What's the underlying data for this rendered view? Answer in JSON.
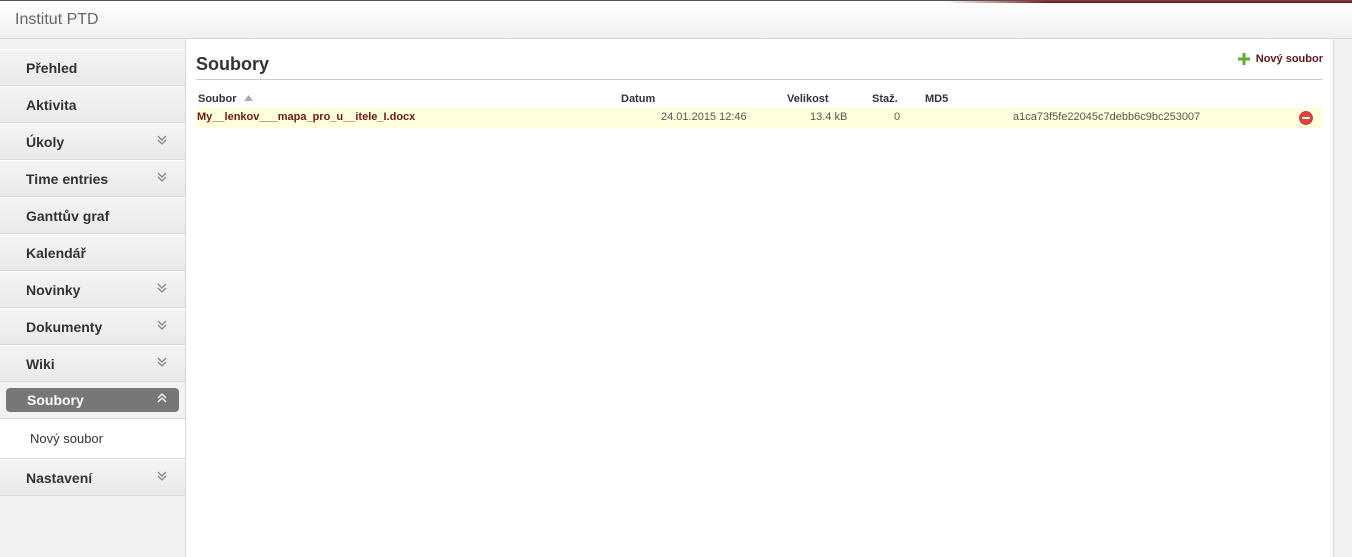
{
  "app": {
    "title": "Institut PTD"
  },
  "sidebar": {
    "items": [
      {
        "label": "Přehled",
        "chevron": false
      },
      {
        "label": "Aktivita",
        "chevron": false
      },
      {
        "label": "Úkoly",
        "chevron": true
      },
      {
        "label": "Time entries",
        "chevron": true
      },
      {
        "label": "Ganttův graf",
        "chevron": false
      },
      {
        "label": "Kalendář",
        "chevron": false
      },
      {
        "label": "Novinky",
        "chevron": true
      },
      {
        "label": "Dokumenty",
        "chevron": true
      },
      {
        "label": "Wiki",
        "chevron": true
      },
      {
        "label": "Soubory",
        "chevron": true,
        "active": true
      },
      {
        "label": "Nastavení",
        "chevron": true
      }
    ],
    "subitem": {
      "label": "Nový soubor"
    }
  },
  "main": {
    "title": "Soubory",
    "new_file_label": "Nový soubor",
    "columns": {
      "file": "Soubor",
      "date": "Datum",
      "size": "Velikost",
      "downloads": "Staž.",
      "md5": "MD5"
    },
    "rows": [
      {
        "file": "My__lenkov___mapa_pro_u__itele_I.docx",
        "date": "24.01.2015 12:46",
        "size": "13.4 kB",
        "downloads": "0",
        "md5": "a1ca73f5fe22045c7debb6c9bc253007"
      }
    ]
  },
  "icons": {
    "chevron": "double-chevron-down-icon",
    "chevron_active": "double-chevron-up-icon",
    "add": "plus-icon",
    "delete": "delete-icon",
    "sort": "sort-asc-icon"
  },
  "colors": {
    "accent": "#8c1414",
    "link": "#6b1a1a",
    "row_highlight": "#ffffdd",
    "active_pill": "#777777",
    "add_icon": "#5cb030",
    "delete_icon": "#e0413a"
  }
}
